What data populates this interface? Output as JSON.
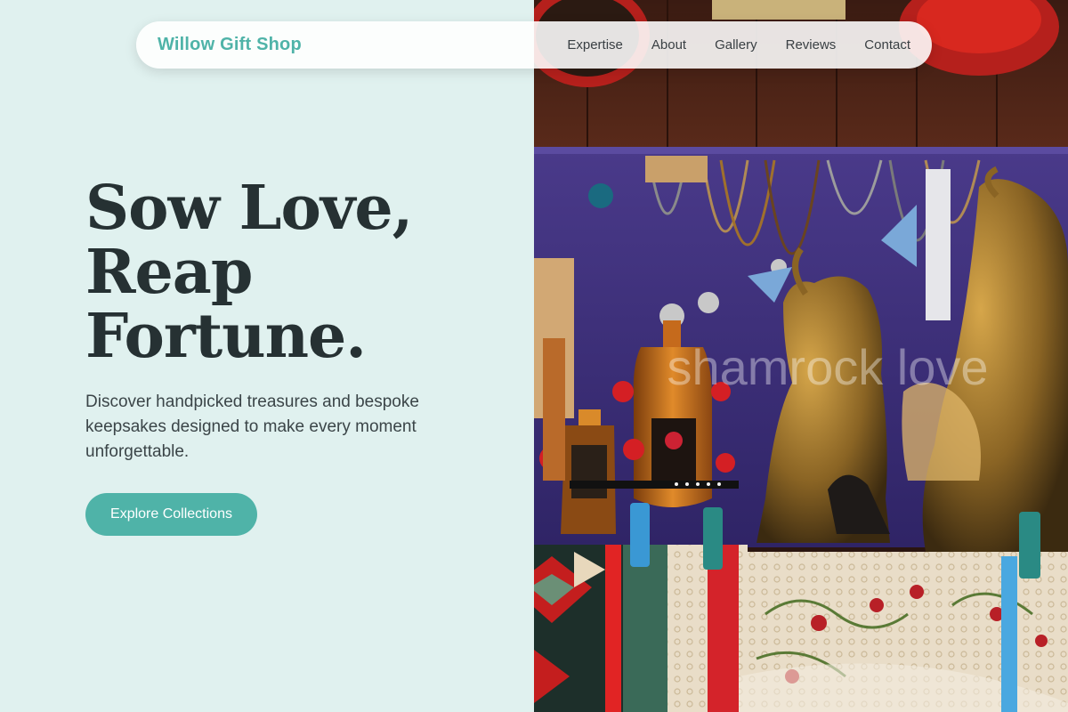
{
  "nav": {
    "brand": "Willow Gift Shop",
    "links": [
      "Expertise",
      "About",
      "Gallery",
      "Reviews",
      "Contact"
    ]
  },
  "hero": {
    "headline_lines": [
      "Sow Love,",
      "Reap",
      "Fortune."
    ],
    "description": "Discover handpicked treasures and bespoke keepsakes designed to make every moment unforgettable.",
    "cta_label": "Explore Collections"
  },
  "photo": {
    "watermark": "shamrock love"
  },
  "colors": {
    "accent": "#4fb3a8",
    "left_background": "#e0f1ef",
    "heading": "#263133",
    "body_text": "#3b4548"
  }
}
